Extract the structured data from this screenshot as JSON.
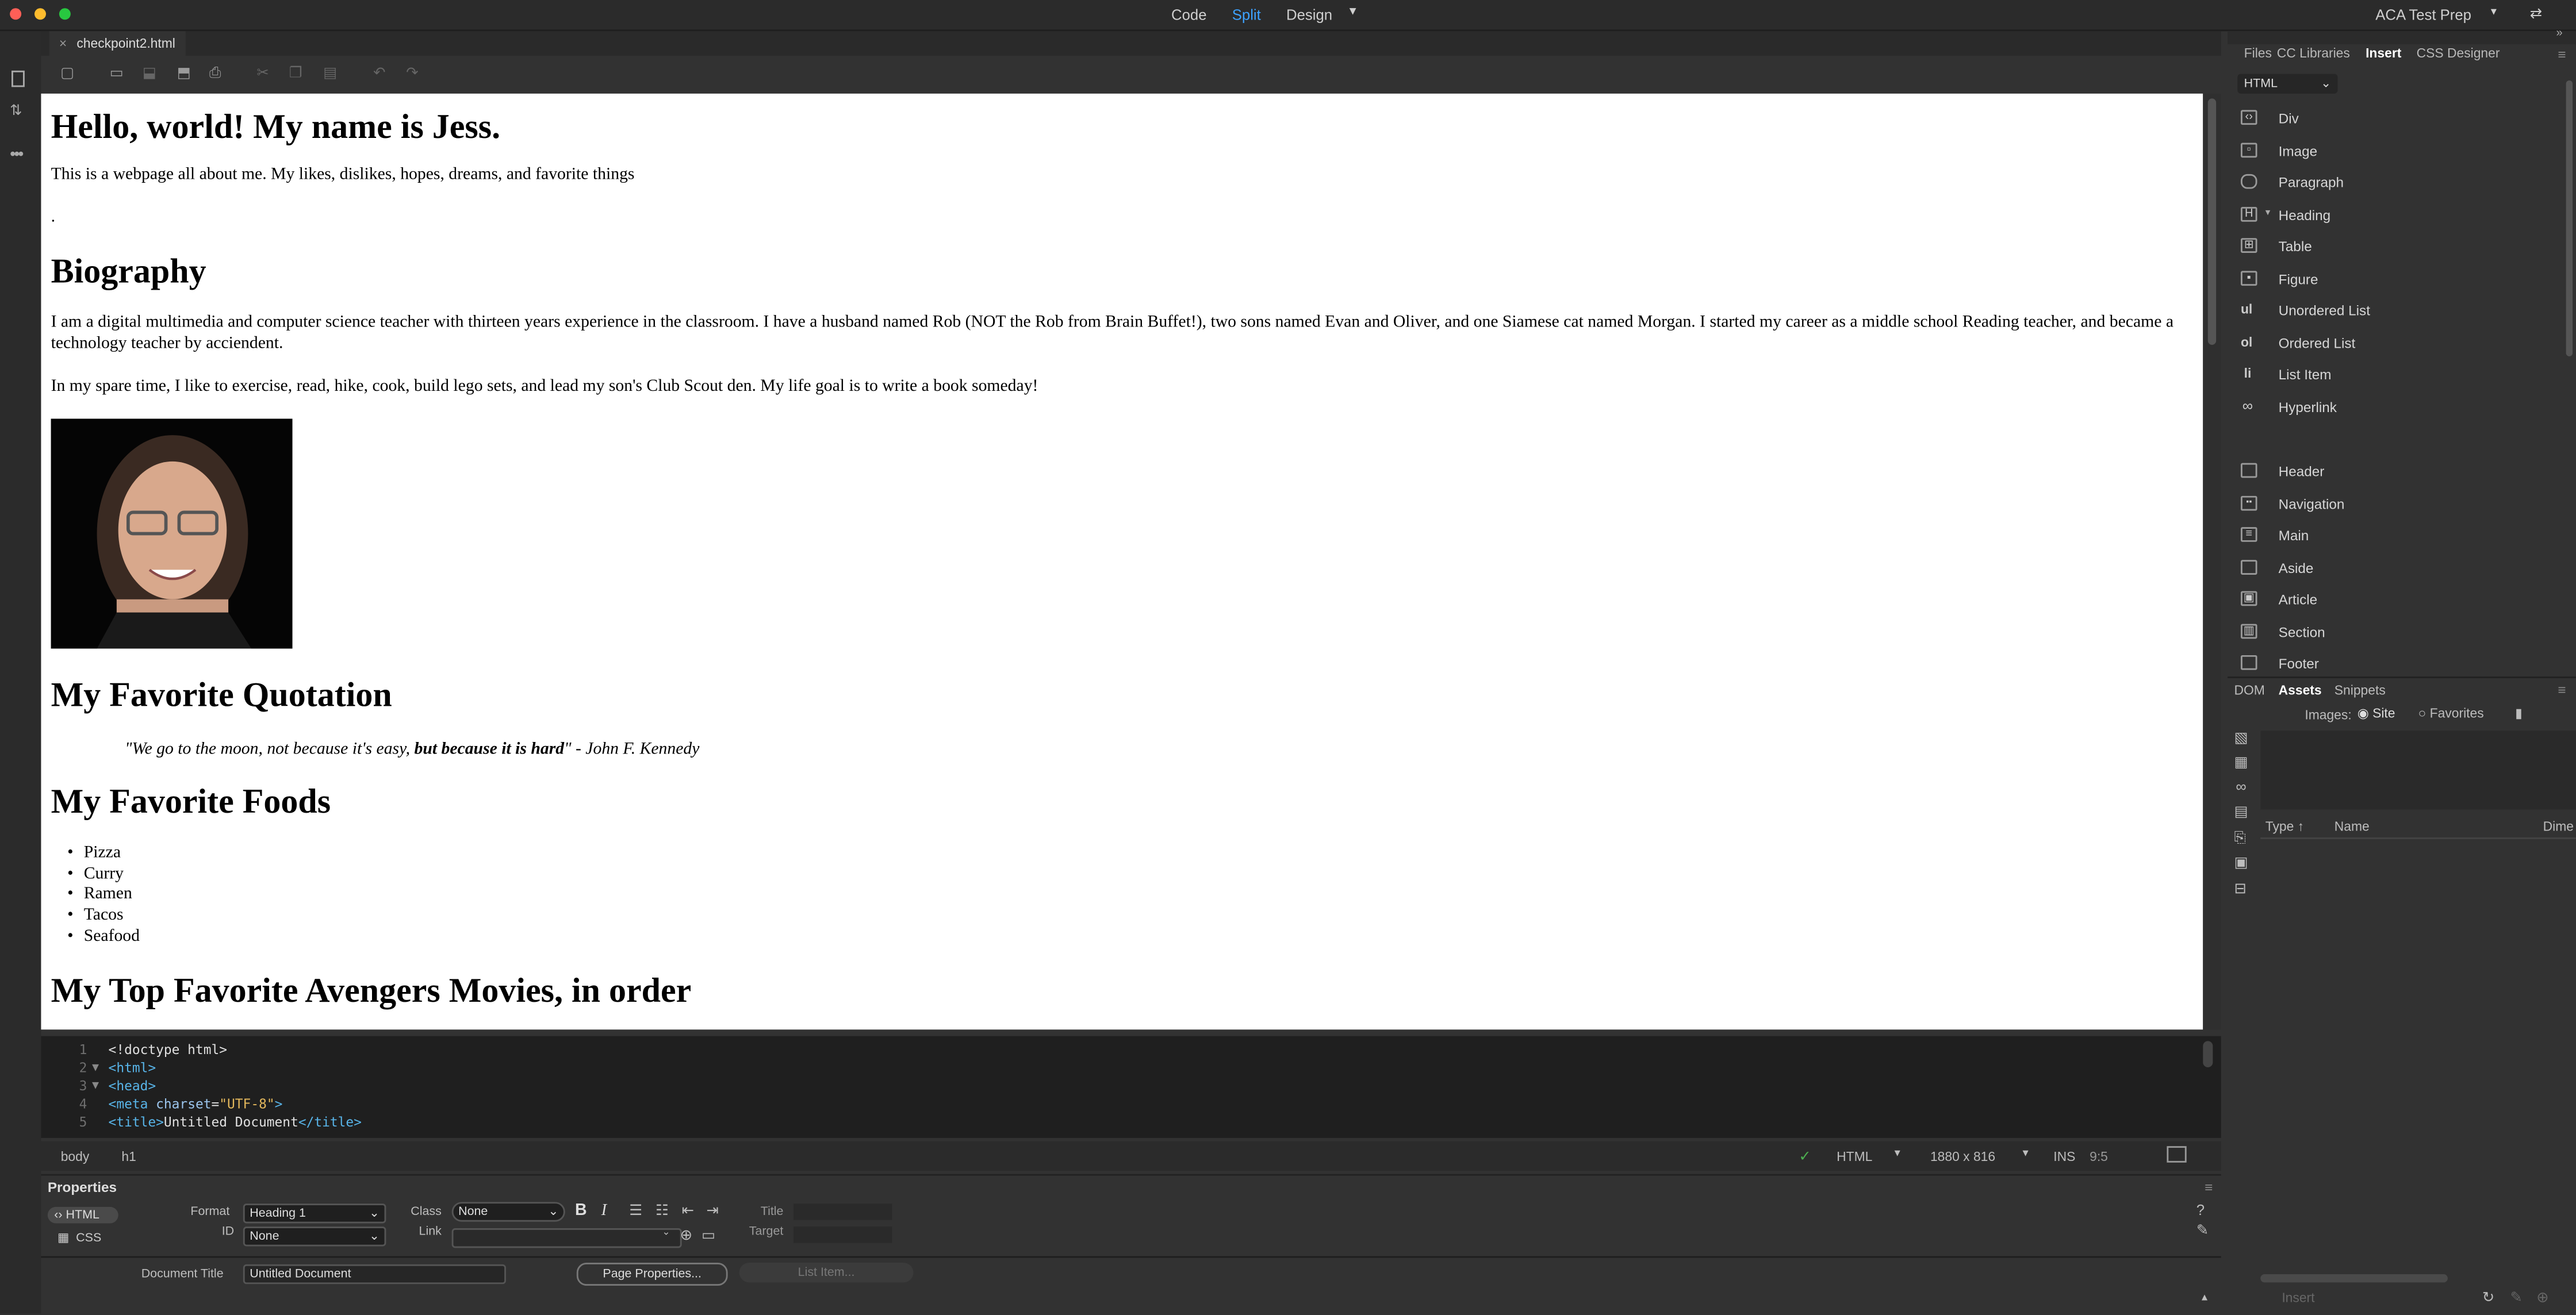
{
  "titlebar": {
    "views": [
      "Code",
      "Split",
      "Design"
    ],
    "active_view": "Split",
    "workspace": "ACA Test Prep"
  },
  "document": {
    "tab": "checkpoint2.html"
  },
  "page": {
    "h1": "Hello, world! My name is Jess.",
    "intro": "This is a webpage all about me. My likes, dislikes, hopes, dreams, and favorite things",
    "dot": ".",
    "bio_heading": "Biography",
    "bio_p1": "I am a digital multimedia and computer science teacher with thirteen years experience in the classroom. I have a husband named Rob (NOT the Rob from Brain Buffet!), two sons named Evan and Oliver, and one Siamese cat named Morgan. I started my career as a middle school Reading teacher, and became a technology teacher by acciendent.",
    "bio_p2": "In my spare time, I like to exercise, read, hike, cook, build lego sets, and lead my son's Club Scout den. My life goal is to write a book someday!",
    "quote_heading": "My Favorite Quotation",
    "quote_a": "\"We go to the moon, not because it's easy, ",
    "quote_b": "but because it is hard",
    "quote_c": "\" - John F. Kennedy",
    "foods_heading": "My Favorite Foods",
    "foods": [
      "Pizza",
      "Curry",
      "Ramen",
      "Tacos",
      "Seafood"
    ],
    "movies_heading": "My Top Favorite Avengers Movies, in order"
  },
  "code": {
    "line_numbers": [
      "1",
      "2",
      "3",
      "4",
      "5"
    ],
    "l1": "<!doctype html>",
    "l2": "<html>",
    "l3": "<head>",
    "l4a": "<meta ",
    "l4b": "charset",
    "l4c": "=",
    "l4d": "\"UTF-8\"",
    "l4e": ">",
    "l5a": "<title>",
    "l5b": "Untitled Document",
    "l5c": "</title>"
  },
  "status": {
    "tags": [
      "body",
      "h1"
    ],
    "language": "HTML",
    "size": "1880 x 816",
    "mode": "INS",
    "position": "9:5"
  },
  "properties": {
    "title": "Properties",
    "html_btn": "HTML",
    "css_btn": "CSS",
    "format_label": "Format",
    "format_value": "Heading 1",
    "id_label": "ID",
    "id_value": "None",
    "class_label": "Class",
    "class_value": "None",
    "link_label": "Link",
    "title_label": "Title",
    "target_label": "Target",
    "doc_title_label": "Document Title",
    "doc_title_value": "Untitled Document",
    "page_props": "Page Properties...",
    "list_item": "List Item..."
  },
  "panel": {
    "tabs": [
      "Files",
      "CC Libraries",
      "Insert",
      "CSS Designer"
    ],
    "active_tab": "Insert",
    "category": "HTML",
    "insert_items_1": [
      "Div",
      "Image",
      "Paragraph",
      "Heading",
      "Table",
      "Figure",
      "Unordered List",
      "Ordered List",
      "List Item",
      "Hyperlink"
    ],
    "insert_items_2": [
      "Header",
      "Navigation",
      "Main",
      "Aside",
      "Article",
      "Section",
      "Footer"
    ],
    "lower_tabs": [
      "DOM",
      "Assets",
      "Snippets"
    ],
    "images_label": "Images:",
    "site": "Site",
    "favorites": "Favorites",
    "col_type": "Type",
    "col_name": "Name",
    "col_dim": "Dime",
    "insert_btn": "Insert"
  }
}
